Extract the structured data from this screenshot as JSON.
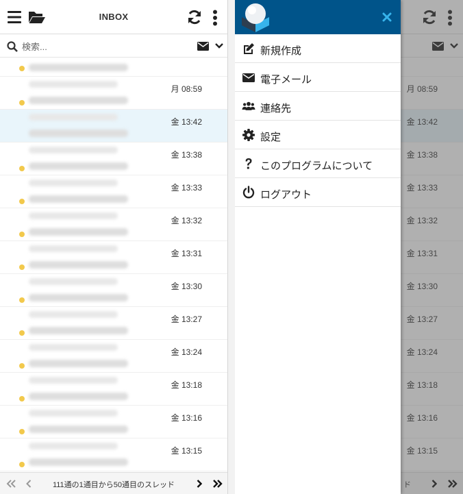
{
  "header": {
    "title": "INBOX"
  },
  "search": {
    "placeholder": "検索..."
  },
  "messages": [
    {
      "date": ""
    },
    {
      "date": "月 08:59"
    },
    {
      "date": "金 13:42",
      "selected": true
    },
    {
      "date": "金 13:38"
    },
    {
      "date": "金 13:33"
    },
    {
      "date": "金 13:32"
    },
    {
      "date": "金 13:31"
    },
    {
      "date": "金 13:30"
    },
    {
      "date": "金 13:27"
    },
    {
      "date": "金 13:24"
    },
    {
      "date": "金 13:18"
    },
    {
      "date": "金 13:16"
    },
    {
      "date": "金 13:15"
    }
  ],
  "footer": {
    "count_text": "111通の1通目から50通目のスレッド",
    "count_text_partial": "ド"
  },
  "menu": {
    "items": [
      {
        "label": "新規作成",
        "icon": "compose-icon"
      },
      {
        "label": "電子メール",
        "icon": "envelope-icon"
      },
      {
        "label": "連絡先",
        "icon": "contacts-icon"
      },
      {
        "label": "設定",
        "icon": "gear-icon"
      },
      {
        "label": "このプログラムについて",
        "icon": "question-icon"
      },
      {
        "label": "ログアウト",
        "icon": "power-icon"
      }
    ]
  },
  "colors": {
    "drawer_header": "#00548a",
    "close": "#37b4ec",
    "unread_dot": "#f2c94c",
    "selected_row": "#e9f5fb"
  }
}
